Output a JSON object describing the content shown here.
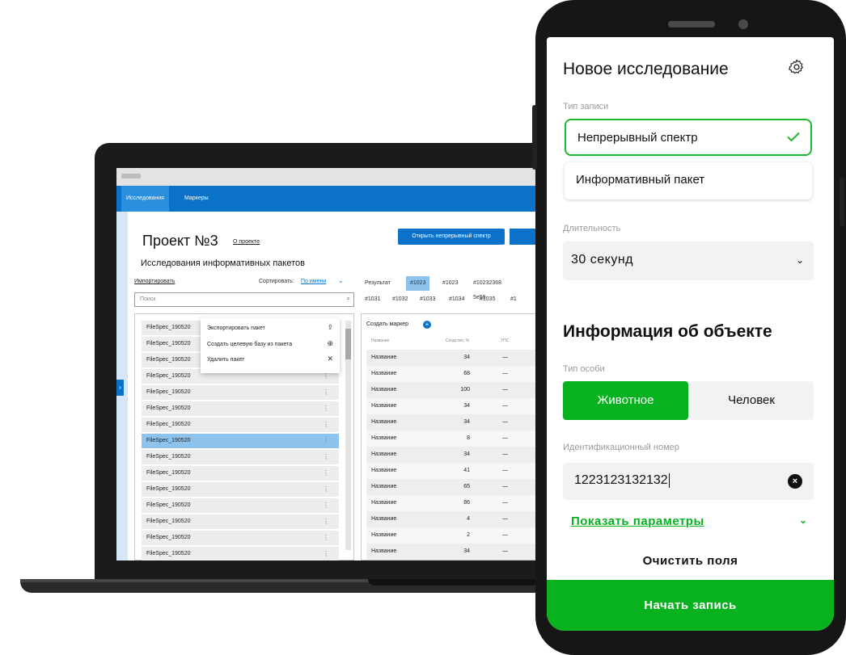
{
  "colors": {
    "brand_blue": "#0a72c9",
    "accent_green": "#08b21f",
    "selected_row": "#8ec3ee"
  },
  "desktop": {
    "nav": {
      "tabs": [
        "Исследования",
        "Маркеры"
      ],
      "active_tab": "Исследования"
    },
    "project_title": "Проект №3",
    "about_link": "О проекте",
    "open_spectrum_button": "Открыть непрерывный спектр",
    "subtitle": "Исследования информативных пакетов",
    "import_link": "Импортировать",
    "sort_label": "Сортировать:",
    "sort_value": "По имени",
    "search_placeholder": "Поиск",
    "files": [
      "FileSpec_190520",
      "FileSpec_190520",
      "FileSpec_190520",
      "FileSpec_190520",
      "FileSpec_190520",
      "FileSpec_190520",
      "FileSpec_190520",
      "FileSpec_190520",
      "FileSpec_190520",
      "FileSpec_190520",
      "FileSpec_190520",
      "FileSpec_190520",
      "FileSpec_190520",
      "FileSpec_190520",
      "FileSpec_190520"
    ],
    "context_menu": {
      "export": "Экспортировать пакет",
      "create_db": "Создать целевую базу из пакета",
      "delete": "Удалить пакет"
    },
    "result_tabs": [
      "Результат",
      "#1023",
      "#1023",
      "#10232368 5e59"
    ],
    "result_tabs_row2": [
      "#1031",
      "#1032",
      "#1033",
      "#1034",
      "#1035",
      "#1"
    ],
    "create_marker": "Создать маркер",
    "table_headers": [
      "Название",
      "Сходство, %",
      "УПС"
    ],
    "rows": [
      {
        "name": "Название",
        "value": "34",
        "ups": "—"
      },
      {
        "name": "Название",
        "value": "68",
        "ups": "—"
      },
      {
        "name": "Название",
        "value": "100",
        "ups": "—"
      },
      {
        "name": "Название",
        "value": "34",
        "ups": "—"
      },
      {
        "name": "Название",
        "value": "34",
        "ups": "—"
      },
      {
        "name": "Название",
        "value": "8",
        "ups": "—"
      },
      {
        "name": "Название",
        "value": "34",
        "ups": "—"
      },
      {
        "name": "Название",
        "value": "41",
        "ups": "—"
      },
      {
        "name": "Название",
        "value": "65",
        "ups": "—"
      },
      {
        "name": "Название",
        "value": "86",
        "ups": "—"
      },
      {
        "name": "Название",
        "value": "4",
        "ups": "—"
      },
      {
        "name": "Название",
        "value": "2",
        "ups": "—"
      },
      {
        "name": "Название",
        "value": "34",
        "ups": "—"
      }
    ]
  },
  "mobile": {
    "title": "Новое исследование",
    "record_type_label": "Тип записи",
    "record_type_selected": "Непрерывный спектр",
    "record_type_other": "Информативный пакет",
    "duration_label": "Длительность",
    "duration_value": "30 секунд",
    "object_info_title": "Информация об объекте",
    "subject_type_label": "Тип особи",
    "subject_animal": "Животное",
    "subject_human": "Человек",
    "id_label": "Идентификационный номер",
    "id_value": "1223123132132",
    "show_params": "Показать параметры",
    "clear_fields": "Очистить поля",
    "start_button": "Начать запись"
  }
}
